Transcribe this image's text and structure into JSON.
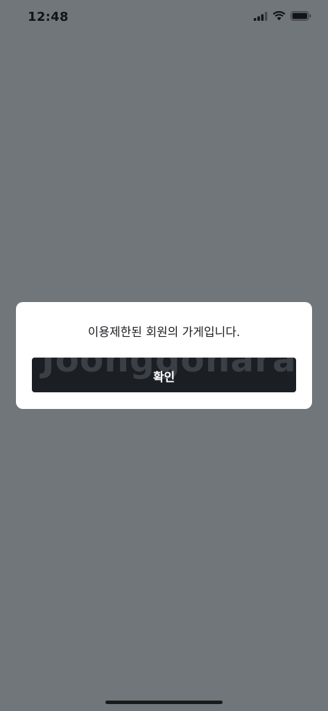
{
  "status_bar": {
    "time": "12:48",
    "icons": [
      "cellular-signal-icon",
      "wifi-icon",
      "battery-icon"
    ]
  },
  "dialog": {
    "message": "이용제한된 회원의 가게입니다.",
    "confirm_label": "확인",
    "watermark": "Joonggonara"
  },
  "colors": {
    "overlay": "#70767a",
    "dialog_bg": "#ffffff",
    "button_bg": "#1b1f24",
    "button_text": "#ffffff",
    "text": "#1b1d20"
  }
}
